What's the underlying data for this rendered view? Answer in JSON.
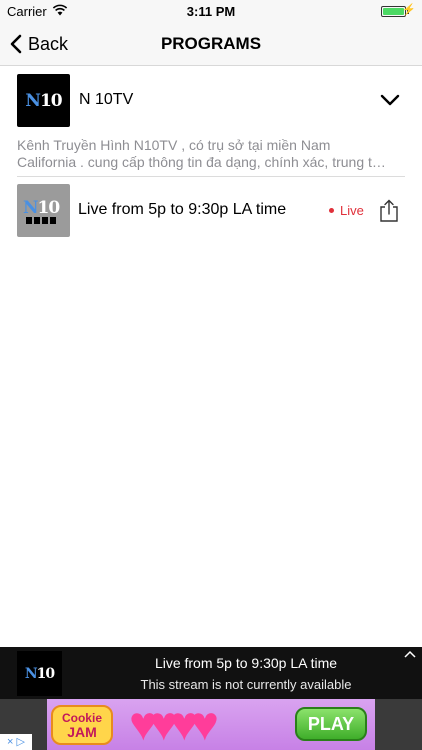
{
  "status_bar": {
    "carrier": "Carrier",
    "time": "3:11 PM"
  },
  "nav": {
    "back_label": "Back",
    "title": "PROGRAMS"
  },
  "channel": {
    "logo_text_n": "N",
    "logo_text_rest": "10",
    "name": "N 10TV",
    "description_line1": "Kênh Truyền Hình N10TV , có trụ sở tại miền Nam",
    "description_line2": "California . cung cấp thông tin đa dạng, chính xác, trung t…"
  },
  "program": {
    "title": "Live from 5p to 9:30p LA time",
    "live_badge": "Live"
  },
  "player": {
    "title": "Live from 5p to 9:30p LA time",
    "status": "This stream is not currently available"
  },
  "ad": {
    "brand_word1": "Cookie",
    "brand_word2": "JAM",
    "cta": "PLAY",
    "hearts": "♥♥♥♥",
    "adchoices_x": "×",
    "adchoices_arrow": "▷"
  },
  "colors": {
    "live": "#e0303a",
    "battery": "#4cd964",
    "logo_accent": "#4a90e2"
  }
}
